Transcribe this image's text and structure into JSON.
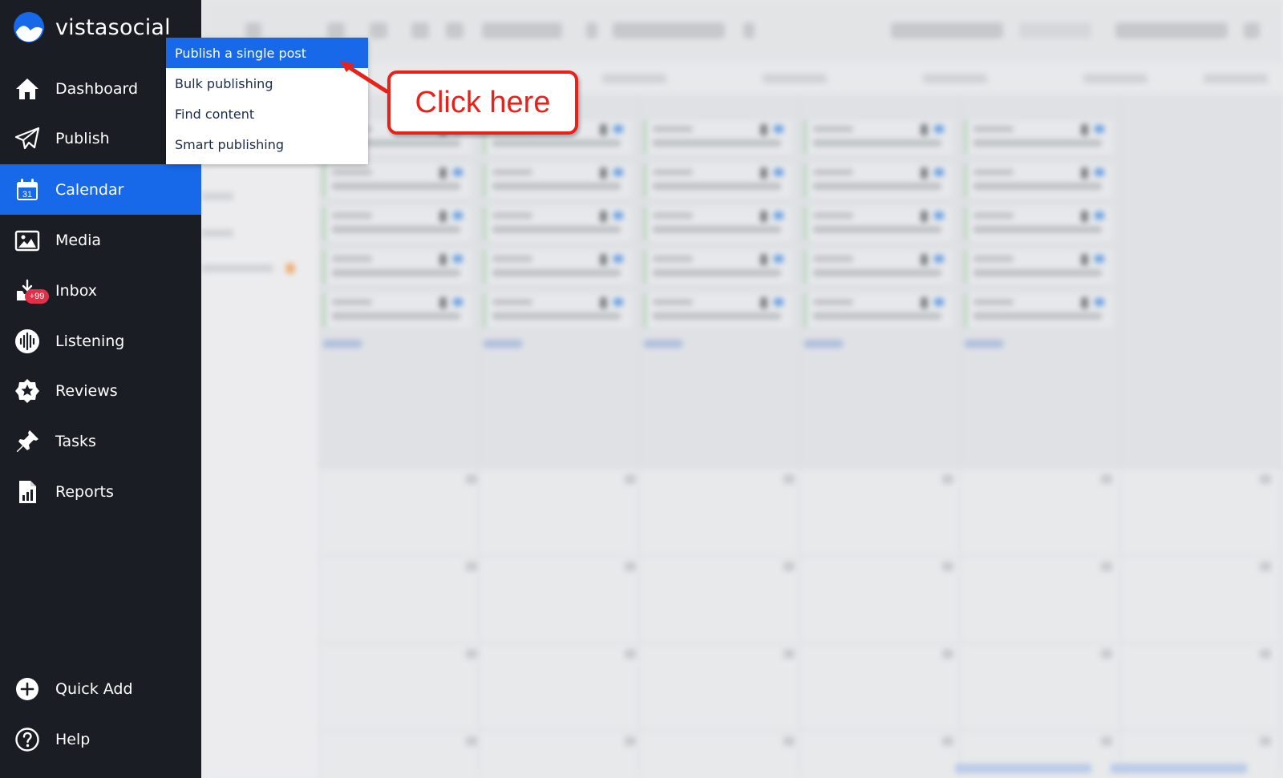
{
  "brand": {
    "name": "vistasocial"
  },
  "sidebar": {
    "items": [
      {
        "label": "Dashboard",
        "icon": "home-icon",
        "active": false
      },
      {
        "label": "Publish",
        "icon": "paper-plane-icon",
        "active": false
      },
      {
        "label": "Calendar",
        "icon": "calendar-icon",
        "active": true,
        "icon_text": "31"
      },
      {
        "label": "Media",
        "icon": "image-icon",
        "active": false
      },
      {
        "label": "Inbox",
        "icon": "inbox-icon",
        "active": false,
        "badge": "+99"
      },
      {
        "label": "Listening",
        "icon": "soundwave-icon",
        "active": false
      },
      {
        "label": "Reviews",
        "icon": "star-badge-icon",
        "active": false
      },
      {
        "label": "Tasks",
        "icon": "pushpin-icon",
        "active": false
      },
      {
        "label": "Reports",
        "icon": "report-document-icon",
        "active": false
      }
    ],
    "bottom_items": [
      {
        "label": "Quick Add",
        "icon": "plus-circle-icon"
      },
      {
        "label": "Help",
        "icon": "question-circle-icon"
      }
    ]
  },
  "publish_menu": {
    "items": [
      {
        "label": "Publish a single post",
        "active": true
      },
      {
        "label": "Bulk publishing",
        "active": false
      },
      {
        "label": "Find content",
        "active": false
      },
      {
        "label": "Smart publishing",
        "active": false
      }
    ]
  },
  "annotation": {
    "text": "Click here"
  },
  "colors": {
    "sidebar_bg": "#1a1d24",
    "accent": "#1769e9",
    "badge": "#e0304a",
    "annotation": "#e6231b"
  }
}
